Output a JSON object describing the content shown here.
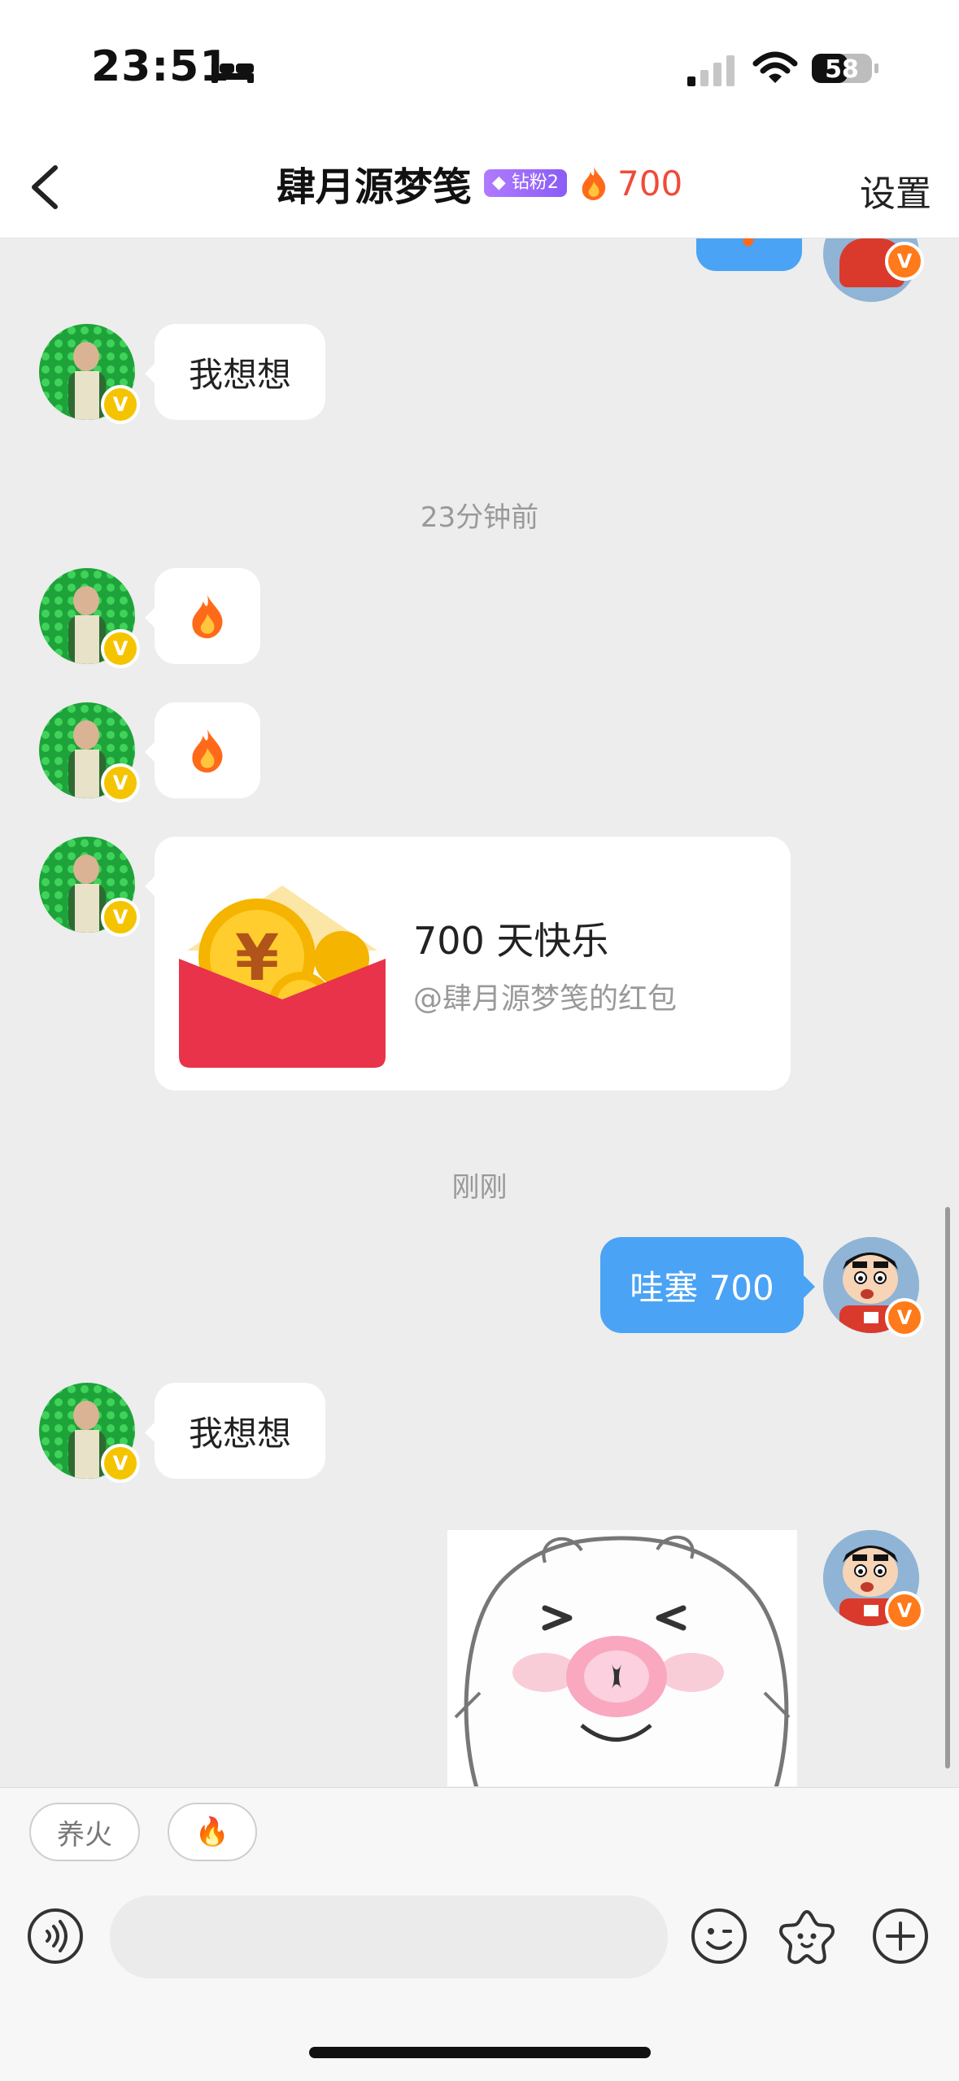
{
  "status_bar": {
    "time": "23:51",
    "battery": "58"
  },
  "header": {
    "back_label": "<",
    "title": "肆月源梦笺",
    "fan_badge": "钻粉2",
    "fire_count": "700",
    "settings_label": "设置"
  },
  "chat": {
    "messages": [
      {
        "side": "left",
        "type": "text",
        "text": "我想想"
      },
      {
        "type": "timestamp",
        "text": "23分钟前"
      },
      {
        "side": "left",
        "type": "emoji",
        "emoji": "🔥"
      },
      {
        "side": "left",
        "type": "emoji",
        "emoji": "🔥"
      },
      {
        "side": "left",
        "type": "red_packet",
        "title": "700 天快乐",
        "subtitle": "@肆月源梦笺的红包"
      },
      {
        "type": "timestamp",
        "text": "刚刚"
      },
      {
        "side": "right",
        "type": "text",
        "text": "哇塞 700"
      },
      {
        "side": "left",
        "type": "text",
        "text": "我想想"
      },
      {
        "side": "right",
        "type": "sticker",
        "sticker": "blushing-pig-sticker"
      }
    ],
    "verified_badge": "V"
  },
  "quick_replies": [
    "养火",
    "🔥"
  ],
  "input": {
    "placeholder": ""
  },
  "colors": {
    "accent_blue": "#4aa3f5",
    "fire_red": "#f04b3a",
    "badge_yellow": "#f5c400",
    "badge_orange": "#ff7a1a"
  }
}
